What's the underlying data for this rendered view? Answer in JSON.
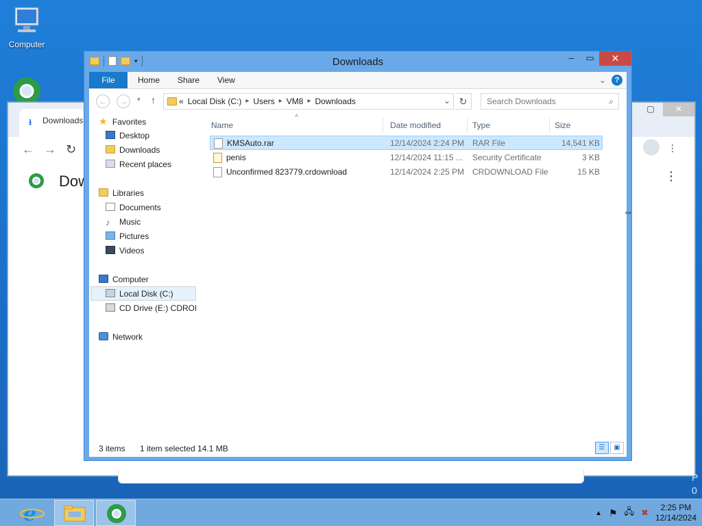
{
  "desktop": {
    "icons": [
      {
        "label": "Computer",
        "icon": "computer-icon"
      },
      {
        "label": "",
        "icon": "chrome-icon"
      }
    ],
    "edge_text": [
      "P",
      "0"
    ]
  },
  "browser": {
    "tab_label": "Downloads",
    "page_title": "Dow",
    "nav": {
      "back": "←",
      "forward": "→",
      "reload": "↻"
    }
  },
  "explorer": {
    "title": "Downloads",
    "ribbon_tabs": [
      "File",
      "Home",
      "Share",
      "View"
    ],
    "help": "?",
    "address": {
      "prefix": "«",
      "crumbs": [
        "Local Disk (C:)",
        "Users",
        "VM8",
        "Downloads"
      ]
    },
    "search": {
      "placeholder": "Search Downloads"
    },
    "nav_pane": {
      "favorites": {
        "label": "Favorites",
        "items": [
          "Desktop",
          "Downloads",
          "Recent places"
        ]
      },
      "libraries": {
        "label": "Libraries",
        "items": [
          "Documents",
          "Music",
          "Pictures",
          "Videos"
        ]
      },
      "computer": {
        "label": "Computer",
        "items": [
          "Local Disk (C:)",
          "CD Drive (E:) CDROM"
        ]
      },
      "network": {
        "label": "Network"
      }
    },
    "columns": [
      "Name",
      "Date modified",
      "Type",
      "Size"
    ],
    "files": [
      {
        "name": "KMSAuto.rar",
        "date": "12/14/2024 2:24 PM",
        "type": "RAR File",
        "size": "14,541 KB",
        "selected": true
      },
      {
        "name": "penis",
        "date": "12/14/2024 11:15 ...",
        "type": "Security Certificate",
        "size": "3 KB",
        "selected": false
      },
      {
        "name": "Unconfirmed 823779.crdownload",
        "date": "12/14/2024 2:25 PM",
        "type": "CRDOWNLOAD File",
        "size": "15 KB",
        "selected": false
      }
    ],
    "status": {
      "count": "3 items",
      "selection": "1 item selected  14.1 MB"
    }
  },
  "taskbar": {
    "clock_time": "2:25 PM",
    "clock_date": "12/14/2024",
    "tray_icons": [
      "show-hidden-icon",
      "action-center-flag-icon",
      "network-icon",
      "volume-muted-icon"
    ]
  },
  "colors": {
    "accent": "#1979ca",
    "selection": "#cce8ff",
    "close": "#c94a44"
  }
}
